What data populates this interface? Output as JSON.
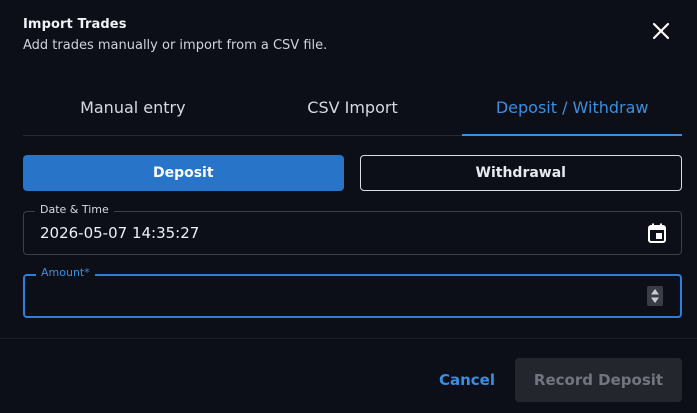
{
  "dialog": {
    "title": "Import Trades",
    "subtitle": "Add trades manually or import from a CSV file.",
    "close_icon": "close-icon"
  },
  "tabs": [
    {
      "label": "Manual entry",
      "active": false
    },
    {
      "label": "CSV Import",
      "active": false
    },
    {
      "label": "Deposit / Withdraw",
      "active": true
    }
  ],
  "toggle": {
    "deposit_label": "Deposit",
    "withdrawal_label": "Withdrawal",
    "selected": "Deposit"
  },
  "date_field": {
    "label": "Date & Time",
    "value": "2026-05-07 14:35:27",
    "icon": "calendar-icon"
  },
  "amount_field": {
    "label": "Amount",
    "required_marker": "*",
    "value": "",
    "icon": "spinner-icon"
  },
  "footer": {
    "cancel_label": "Cancel",
    "submit_label": "Record Deposit",
    "submit_disabled": true
  },
  "colors": {
    "accent": "#3a8fe0",
    "selected_toggle": "#2774c8",
    "background": "#0c0e18",
    "disabled_button": "#24262e"
  }
}
